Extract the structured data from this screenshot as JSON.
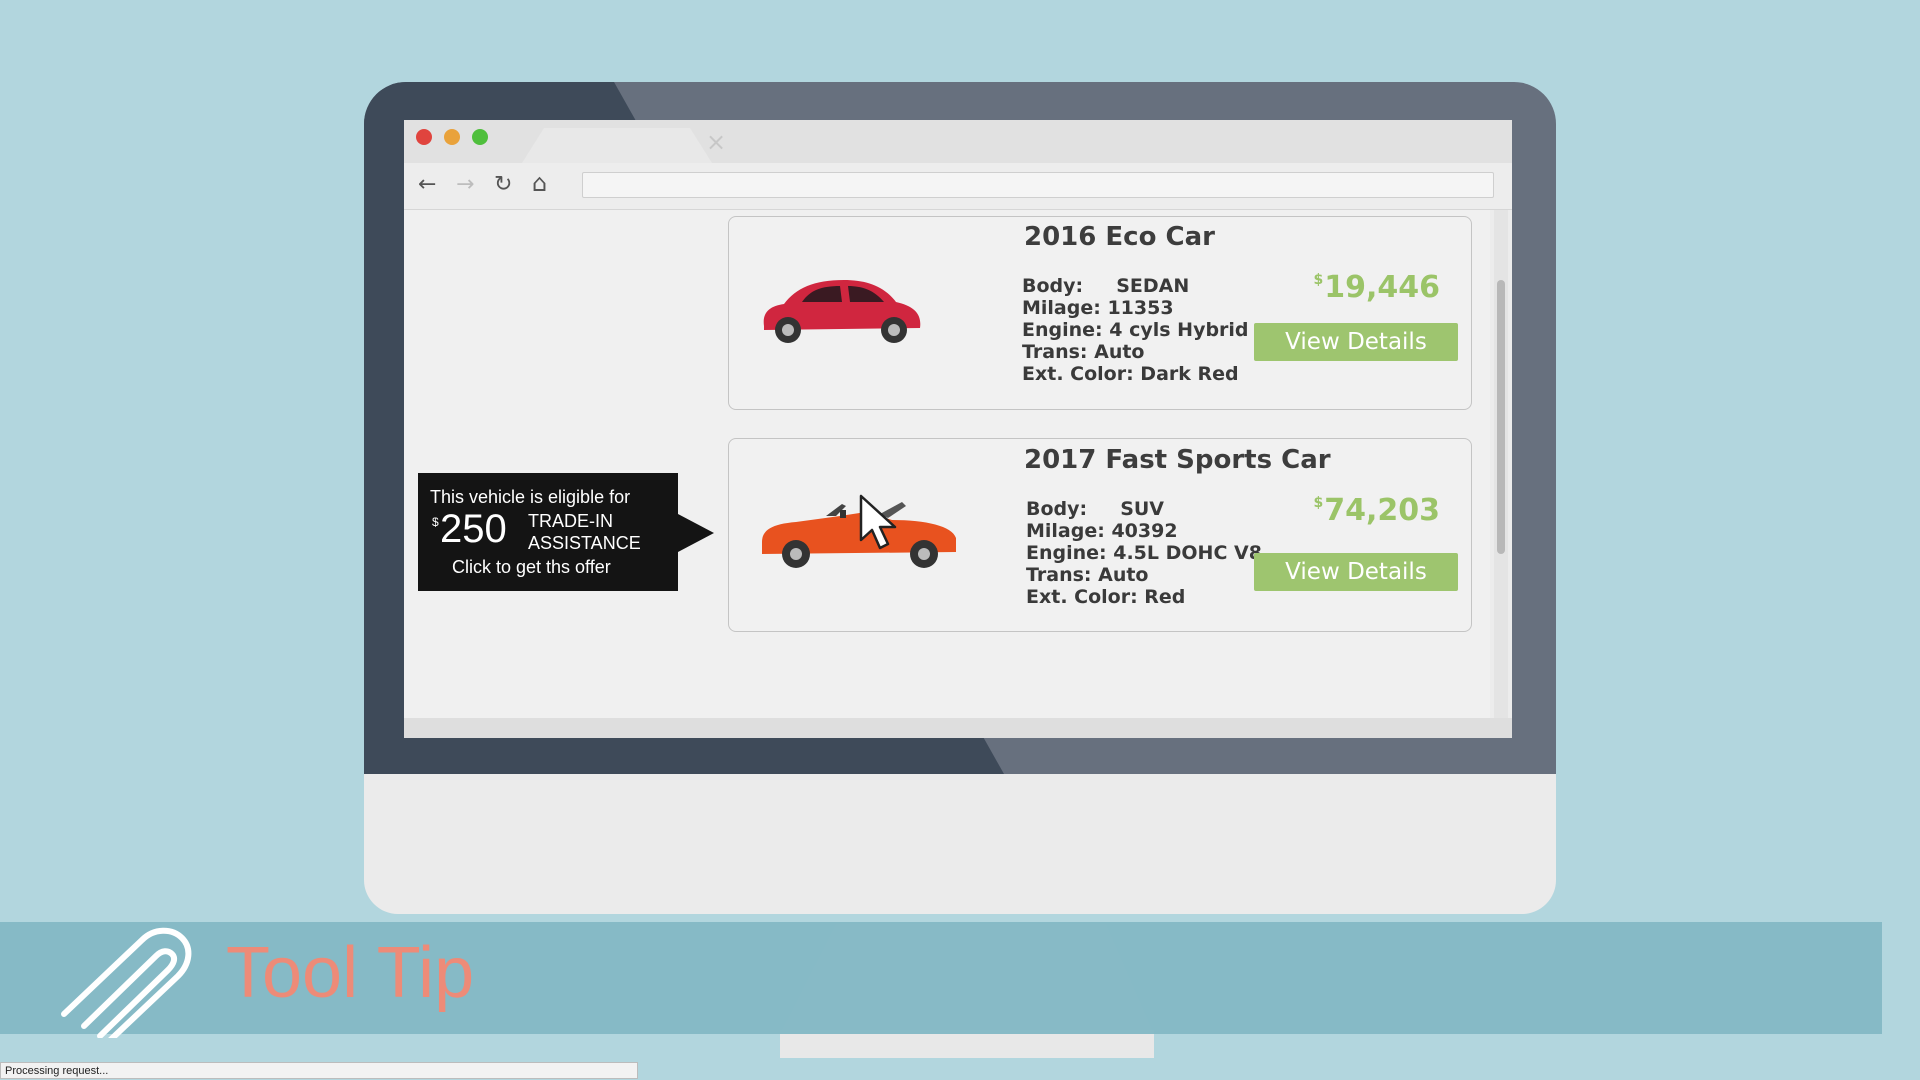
{
  "browser": {
    "tab_close_glyph": "×",
    "nav": {
      "back": "←",
      "forward": "→",
      "reload": "↻",
      "home": "⌂"
    },
    "address_value": "",
    "window_buttons": {
      "close_color": "#e0443e",
      "minimize_color": "#e9a23b",
      "maximize_color": "#4fbf3c"
    }
  },
  "listings": [
    {
      "title": "2016 Eco Car",
      "specs": [
        "Body:     SEDAN",
        "Milage: 11353",
        "Engine: 4 cyls Hybrid",
        "Trans: Auto",
        "Ext. Color: Dark Red"
      ],
      "price_currency": "$",
      "price": "19,446",
      "button_label": "View Details",
      "car_color": "#d0263f"
    },
    {
      "title": "2017 Fast Sports Car",
      "specs": [
        "Body:     SUV",
        "Milage: 40392",
        "Engine: 4.5L DOHC V8",
        "Trans: Auto",
        "Ext. Color: Red"
      ],
      "price_currency": "$",
      "price": "74,203",
      "button_label": "View Details",
      "car_color": "#e8521f"
    }
  ],
  "tooltip": {
    "line1": "This vehicle is eligible for",
    "currency": "$",
    "amount": "250",
    "trade_in": "TRADE-IN",
    "assistance": "ASSISTANCE",
    "cta": "Click to get ths offer"
  },
  "banner": {
    "title": "Tool Tip",
    "icon": "paperclip-icon"
  },
  "status_bar": {
    "text": "Processing request..."
  },
  "colors": {
    "accent_green": "#9ec56f",
    "price_green": "#9bc468",
    "banner_title": "#ed8b78"
  }
}
